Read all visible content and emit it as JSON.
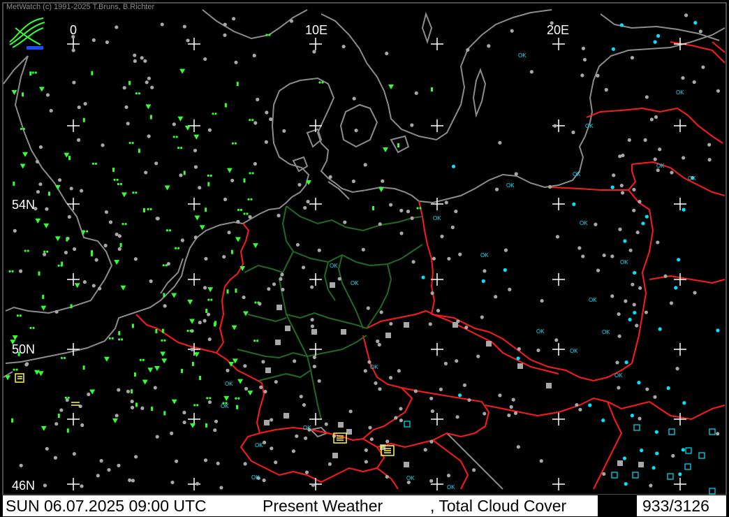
{
  "copyright": "MetWatch  (c) 1991-2025 T.Bruns, B.Richter",
  "longitude_labels": [
    "0",
    "10E",
    "20E"
  ],
  "latitude_labels": [
    "54N",
    "50N",
    "46N"
  ],
  "status_bar": {
    "date_time": "SUN 06.07.2025 09:00 UTC",
    "product": "Present Weather",
    "overlay": ", Total Cloud Cover",
    "station_count": "933/3126"
  },
  "station_ok_label": "OK",
  "colors": {
    "background": "#000000",
    "coastline": "#8c8c8c",
    "country_border_red": "#ff1a1a",
    "state_border_green": "#1f6b1f",
    "grid_cross": "#ffffff",
    "station_grey": "#a8a8a8",
    "station_cyan": "#00e5ff",
    "weather_green": "#33ff33",
    "weather_yellow": "#ffff33"
  }
}
